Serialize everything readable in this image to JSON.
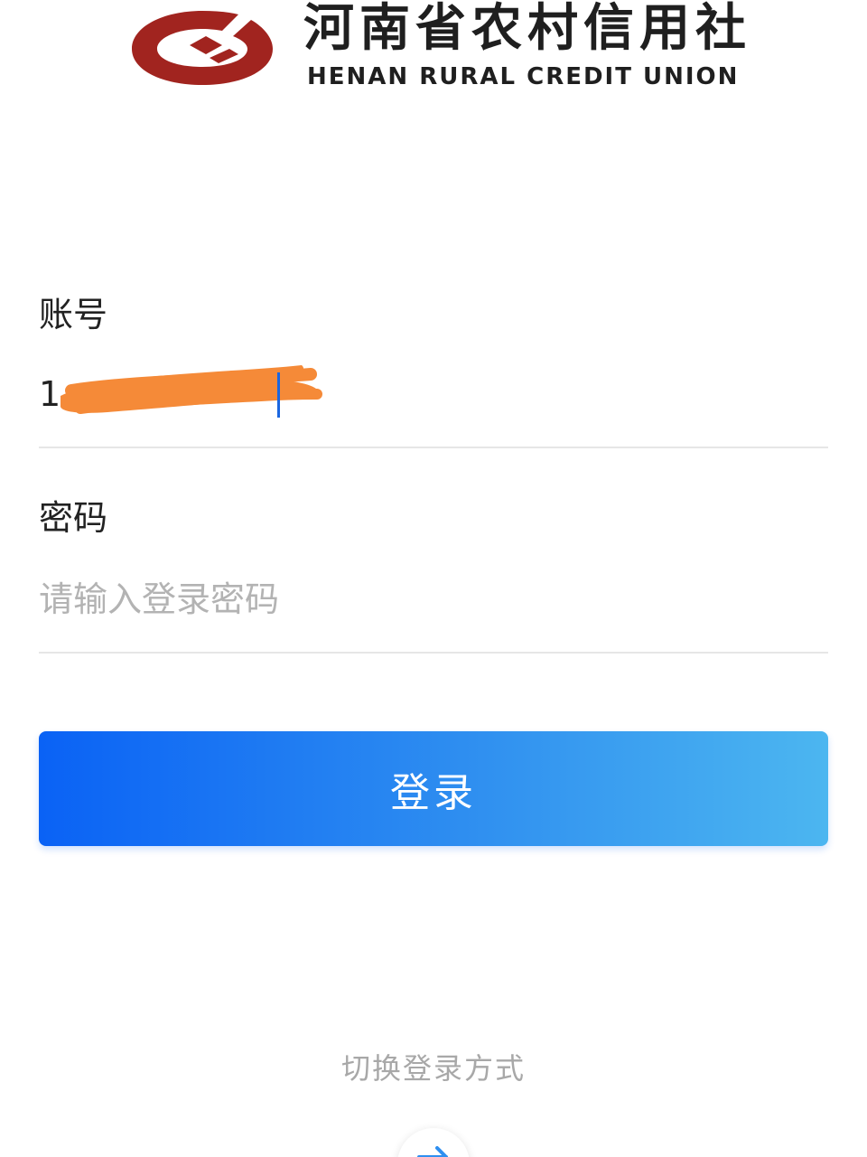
{
  "brand": {
    "name_cn": "河南省农村信用社",
    "name_en": "HENAN RURAL CREDIT UNION",
    "logo_color": "#a1241f"
  },
  "account": {
    "label": "账号",
    "value_visible": "1",
    "redaction_color": "#f58a38"
  },
  "password": {
    "label": "密码",
    "placeholder": "请输入登录密码"
  },
  "login_button": {
    "label": "登录",
    "gradient_start": "#0a62f5",
    "gradient_end": "#4cb6f0"
  },
  "switch_method": {
    "label": "切换登录方式",
    "icon": "arrow-right-icon"
  }
}
